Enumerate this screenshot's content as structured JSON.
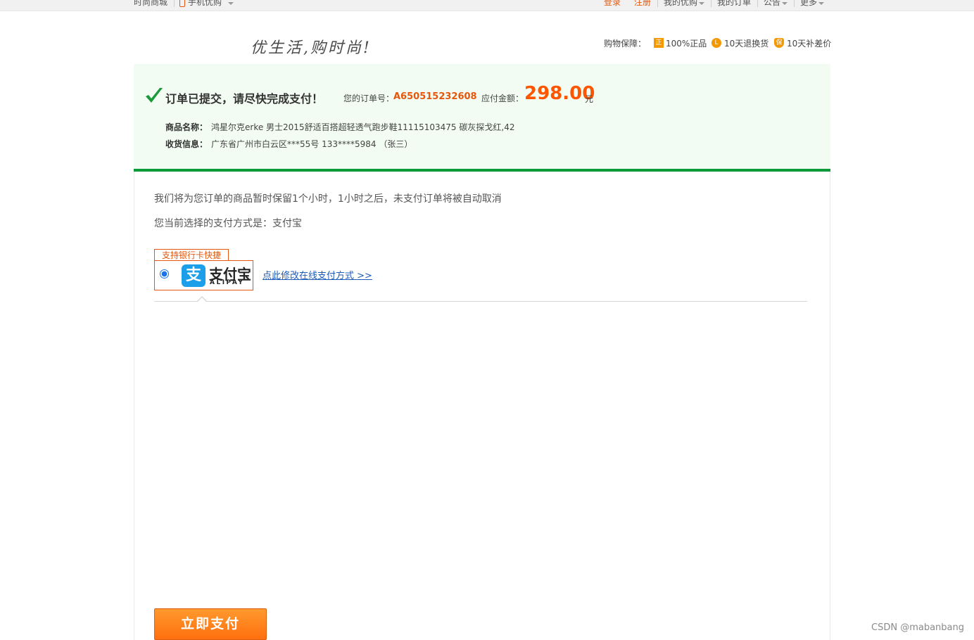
{
  "topbar": {
    "site_name": "时尚商城",
    "mobile": "手机优购",
    "login": "登录",
    "register": "注册",
    "my_youguo": "我的优购",
    "my_orders": "我的订单",
    "notice": "公告",
    "more": "更多"
  },
  "header": {
    "slogan": "优生活,购时尚!",
    "guarantee_label": "购物保障：",
    "guarantees": [
      {
        "icon": "正",
        "text": "100%正品"
      },
      {
        "icon": "L",
        "text": "10天退换货"
      },
      {
        "icon": "保",
        "text": "10天补差价"
      }
    ]
  },
  "order": {
    "title": "订单已提交，请尽快完成支付！",
    "order_no_label": "您的订单号：",
    "order_no": "A650515232608",
    "amount_label": "应付金额：",
    "amount": "298.00",
    "amount_unit": "元",
    "product_label": "商品名称：",
    "product_value": "鸿星尔克erke 男士2015舒适百搭超轻透气跑步鞋11115103475 碳灰探戈红,42",
    "shipping_label": "收货信息：",
    "shipping_value": "广东省广州市白云区***55号 133****5984 （张三）"
  },
  "payment": {
    "hold_notice": "我们将为您订单的商品暂时保留1个小时，1小时之后，未支付订单将被自动取消",
    "method_notice": "您当前选择的支付方式是：支付宝",
    "bank_tag": "支持银行卡快捷",
    "alipay_logo_char": "支",
    "alipay_cn": "支付宝",
    "alipay_en": "ALIPAY",
    "change_link": "点此修改在线支付方式 >>",
    "pay_button": "立即支付"
  },
  "watermark": "CSDN @mabanbang",
  "colors": {
    "accent_orange": "#ff5500",
    "success_green": "#0c9a3a",
    "panel_bg": "#f2fcf2",
    "alipay_blue": "#1a9fe8",
    "link_blue": "#1d5bb8"
  }
}
